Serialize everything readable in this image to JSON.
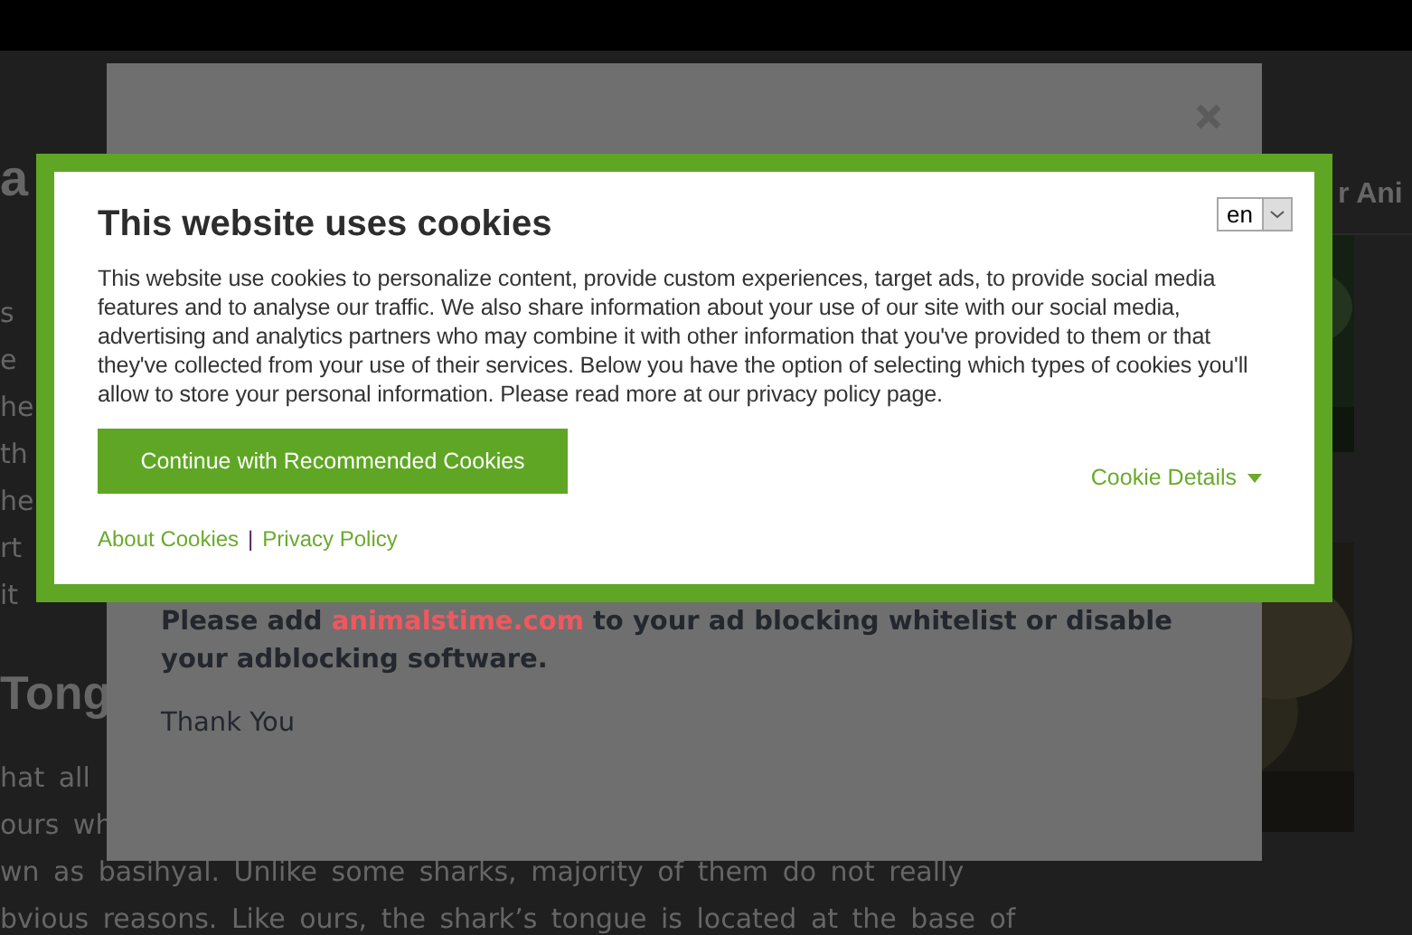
{
  "background_page": {
    "heading_fragment": "a",
    "sidebar_heading_fragment": "r Ani",
    "side_fragments": [
      "s",
      "e",
      "he",
      "th",
      "he",
      "rt",
      "it"
    ],
    "section_heading_fragment": "Tong",
    "paragraph_lines": [
      "hat all",
      "ours wh",
      "wn as basihyal. Unlike some sharks, majority of them do not really",
      "bvious reasons. Like ours, the shark’s tongue is located at the base of"
    ]
  },
  "adblock_dialog": {
    "message_before": "Please add",
    "link": "animalstime.com",
    "message_after": "to your ad blocking whitelist or disable your adblocking software.",
    "thanks": "Thank You"
  },
  "cookie_banner": {
    "title": "This website uses cookies",
    "language": "en",
    "body": "This website use cookies to personalize content, provide custom experiences, target ads, to provide social media features and to analyse our traffic. We also share information about your use of our site with our social media, advertising and analytics partners who may combine it with other information that you've provided to them or that they've collected from your use of their services. Below you have the option of selecting which types of cookies you'll allow to store your personal information. Please read more at our privacy policy page.",
    "accept_button": "Continue with Recommended Cookies",
    "details_link": "Cookie Details",
    "footer_links": [
      "About Cookies",
      "Privacy Policy"
    ],
    "separator": "|"
  }
}
